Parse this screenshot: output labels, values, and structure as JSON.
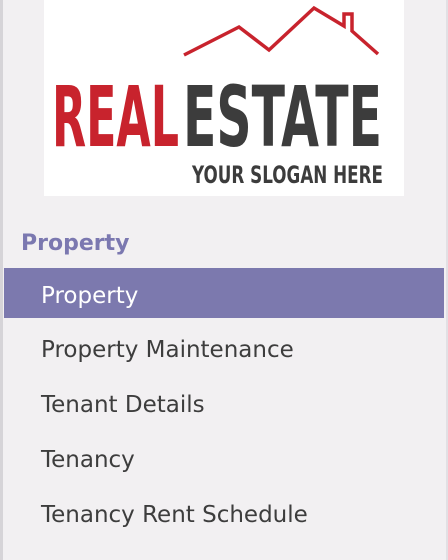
{
  "logo": {
    "word_red": "REAL",
    "word_dark": "ESTATE",
    "slogan": "YOUR SLOGAN HERE",
    "red_color": "#c8232d",
    "dark_color": "#3c3c3c",
    "icon": "house-roof-icon"
  },
  "sidebar": {
    "section_title": "Property",
    "items": [
      {
        "label": "Property",
        "active": true
      },
      {
        "label": "Property Maintenance",
        "active": false
      },
      {
        "label": "Tenant Details",
        "active": false
      },
      {
        "label": "Tenancy",
        "active": false
      },
      {
        "label": "Tenancy Rent Schedule",
        "active": false
      }
    ]
  },
  "colors": {
    "accent": "#7c79ae",
    "section_title": "#7b78b0",
    "background": "#f2f0f2",
    "text": "#3d3d3d"
  }
}
